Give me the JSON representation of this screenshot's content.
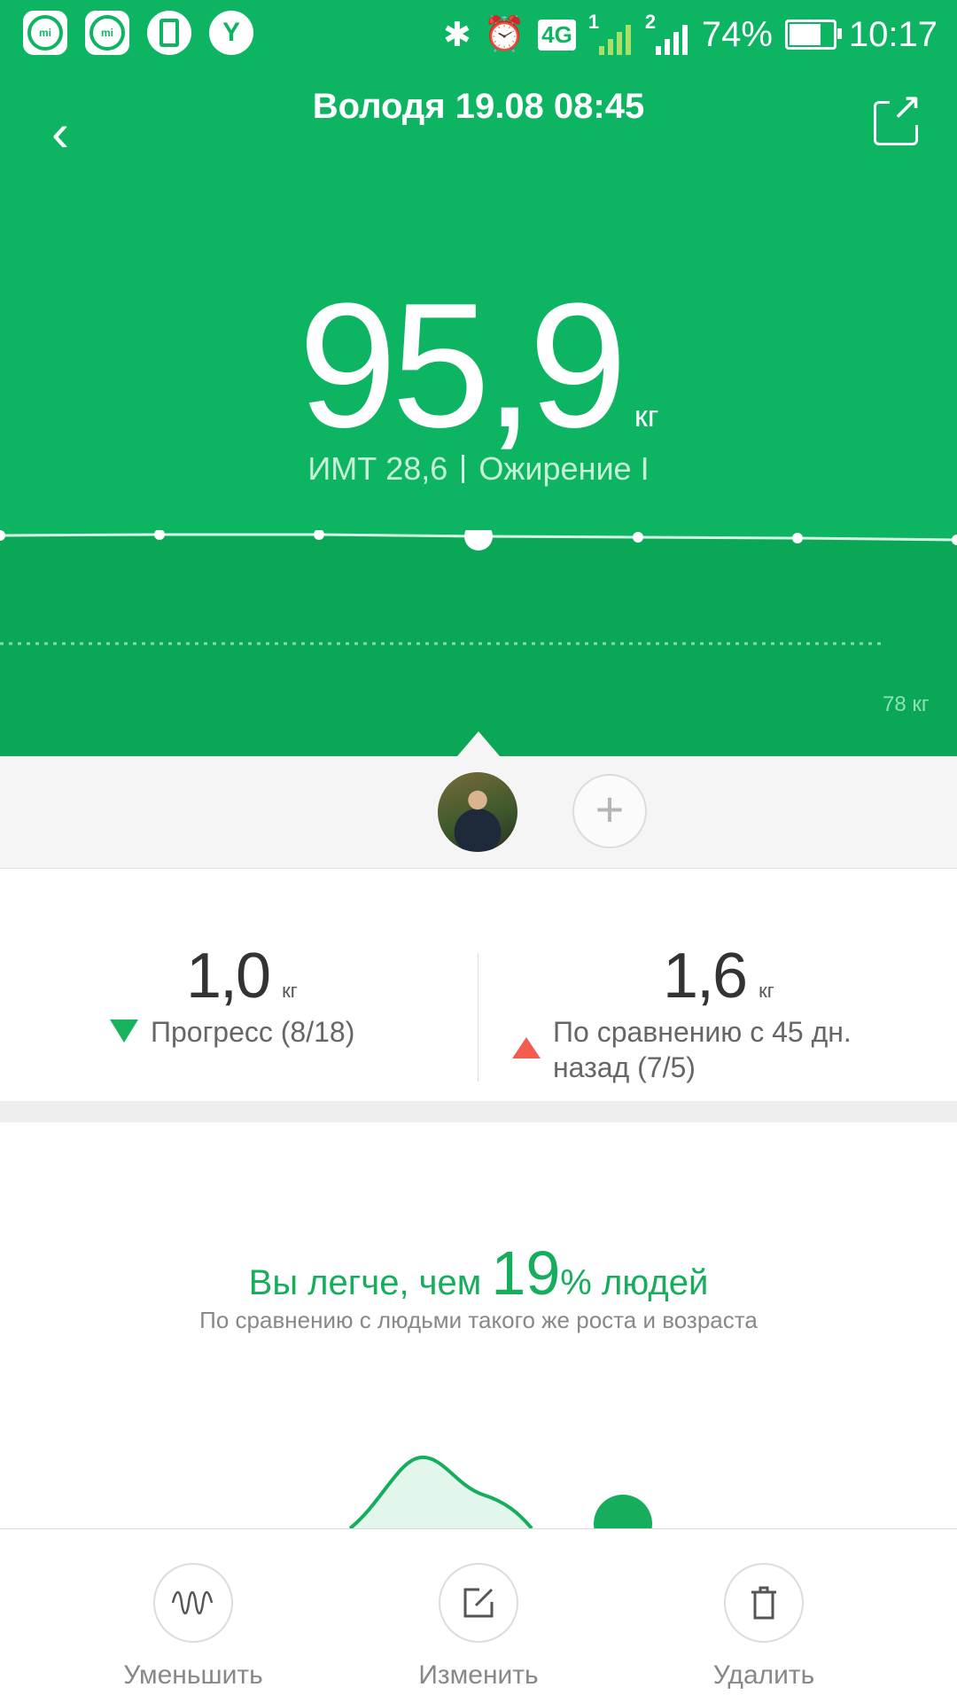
{
  "status_bar": {
    "network": "4G",
    "sim1": "1",
    "sim2": "2",
    "battery_percent": "74%",
    "battery_level": 0.74,
    "time": "10:17",
    "app_icons": [
      "mi-fit-icon",
      "mi-fit-icon",
      "battery-saver-icon",
      "yandex-icon"
    ]
  },
  "header": {
    "title": "Володя 19.08 08:45",
    "weight_value": "95,9",
    "weight_unit": "кг",
    "bmi_text": "ИМТ 28,6",
    "bmi_category": "Ожирение I",
    "reference_label": "78 кг"
  },
  "trend": {
    "points": [
      95.9,
      95.9,
      95.9,
      95.9,
      95.9,
      95.9,
      95.9
    ],
    "selected_index": 3
  },
  "progress": {
    "left_value": "1,0",
    "left_unit": "кг",
    "left_label": "Прогресс (8/18)",
    "right_value": "1,6",
    "right_unit": "кг",
    "right_label": "По сравнению с 45 дн. назад (7/5)"
  },
  "comparison": {
    "prefix": "Вы легче, чем",
    "percent": "19",
    "suffix": "% людей",
    "subtitle": "По сравнению с людьми такого же роста и возраста"
  },
  "actions": {
    "reduce_label": "Уменьшить",
    "edit_label": "Изменить",
    "delete_label": "Удалить"
  },
  "colors": {
    "brand_green": "#0db562",
    "accent_green": "#16ad5c",
    "down_arrow": "#19b35f",
    "up_arrow": "#f25d50"
  }
}
